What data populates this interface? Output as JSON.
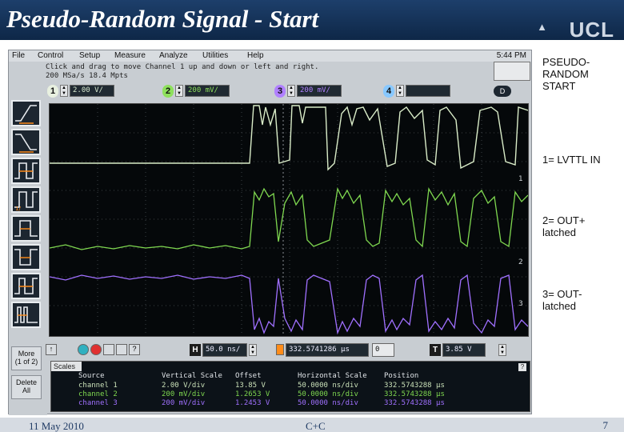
{
  "slide": {
    "title": "Pseudo-Random Signal - Start",
    "logo": "UCL",
    "footer_date": "11 May 2010",
    "footer_center": "C+C",
    "page_number": "7"
  },
  "scope": {
    "menu": [
      "File",
      "Control",
      "Setup",
      "Measure",
      "Analyze",
      "Utilities",
      "Help"
    ],
    "clock": "5:44 PM",
    "instruction_line1": "Click and drag to move Channel 1 up and down or left and right.",
    "instruction_line2": "200 MSa/s   18.4 Mpts",
    "channels": [
      {
        "number": "1",
        "scale": "2.00 V/",
        "color": "#d8ead0"
      },
      {
        "number": "2",
        "scale": "200 mV/",
        "color": "#8ee05c"
      },
      {
        "number": "3",
        "scale": "200 mV/",
        "color": "#b080ff"
      },
      {
        "number": "4",
        "scale": "",
        "color": "#88c8ff"
      }
    ],
    "digital_label": "D",
    "side_buttons": {
      "more": "More",
      "more_sub": "(1 of 2)",
      "delete": "Delete",
      "delete_sub": "All"
    },
    "horizontal": {
      "tag": "H",
      "value": "50.0 ns/",
      "offset": "332.5741286 µs",
      "offset_step": "0"
    },
    "trigger": {
      "tag": "T",
      "value": "3.85 V"
    },
    "meas_tab": "Scales",
    "meas_headers": [
      "Source",
      "Vertical Scale",
      "Offset",
      "Horizontal Scale",
      "Position"
    ],
    "meas_rows": [
      [
        "channel 1",
        "2.00 V/div",
        "13.85 V",
        "50.0000 ns/div",
        "332.5743288 µs"
      ],
      [
        "channel 2",
        "200 mV/div",
        "1.2653 V",
        "50.0000 ns/div",
        "332.5743288 µs"
      ],
      [
        "channel 3",
        "200 mV/div",
        "1.2453 V",
        "50.0000 ns/div",
        "332.5743288 µs"
      ]
    ],
    "colors": {
      "ch1": "#d8ead0",
      "ch2": "#7fd850",
      "ch3": "#a070ff",
      "screen_bg": "#05080a"
    }
  },
  "notes": {
    "n1_a": "PSEUDO-",
    "n1_b": "RANDOM",
    "n1_c": "START",
    "n2": "1= LVTTL IN",
    "n3_a": "2= OUT+",
    "n3_b": "latched",
    "n4_a": "3= OUT-",
    "n4_b": "latched"
  }
}
